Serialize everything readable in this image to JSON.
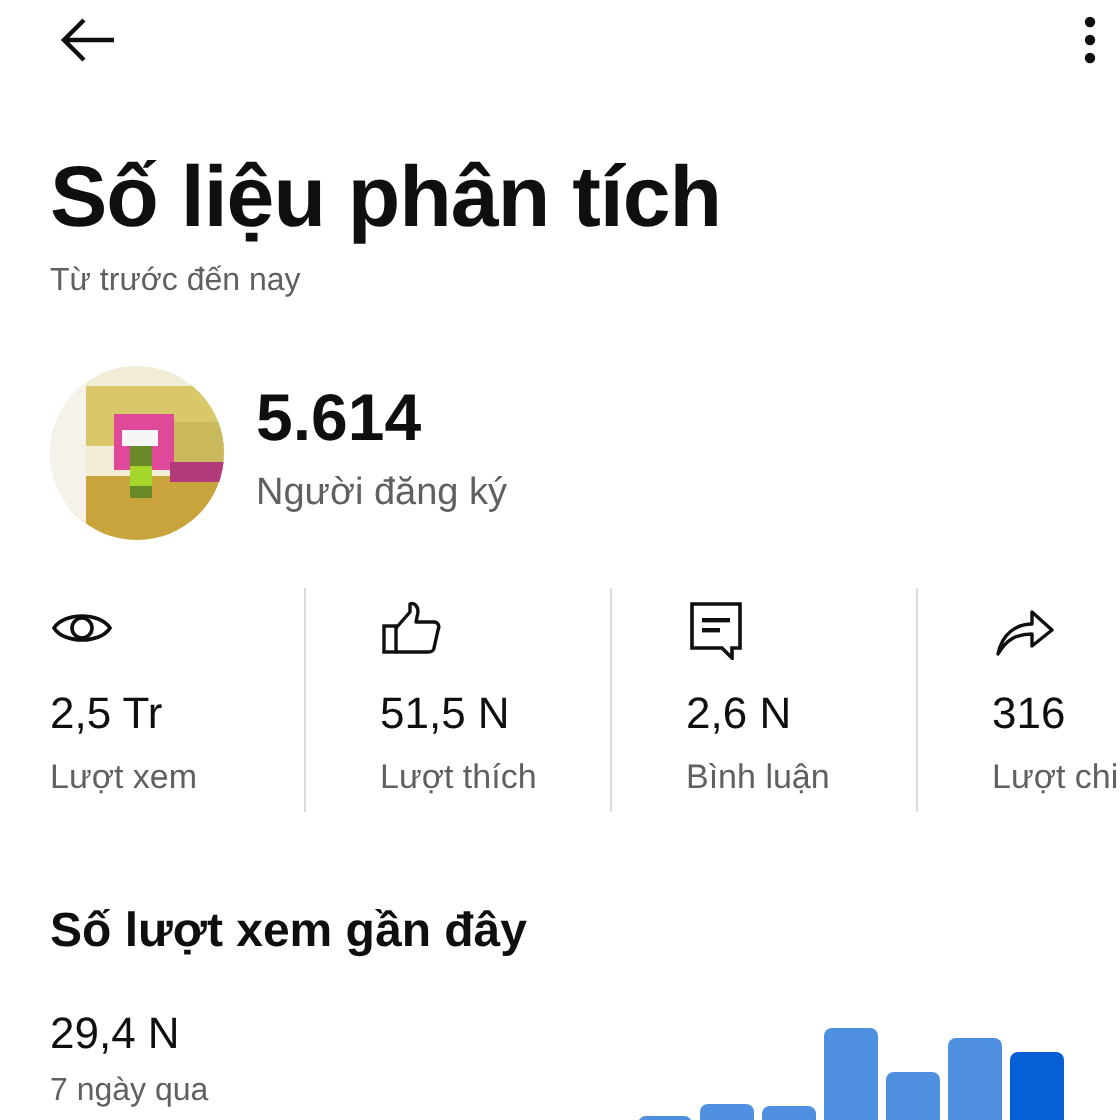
{
  "title": "Số liệu phân tích",
  "subtitle": "Từ trước đến nay",
  "channel": {
    "subscribers": "5.614",
    "subscribers_label": "Người đăng ký"
  },
  "stats": [
    {
      "kind": "views",
      "value": "2,5 Tr",
      "label": "Lượt xem"
    },
    {
      "kind": "likes",
      "value": "51,5 N",
      "label": "Lượt thích"
    },
    {
      "kind": "comments",
      "value": "2,6 N",
      "label": "Bình luận"
    },
    {
      "kind": "shares",
      "value": "316",
      "label": "Lượt chi"
    }
  ],
  "recent": {
    "heading": "Số lượt xem gần đây",
    "value": "29,4 N",
    "period": "7 ngày qua"
  }
}
